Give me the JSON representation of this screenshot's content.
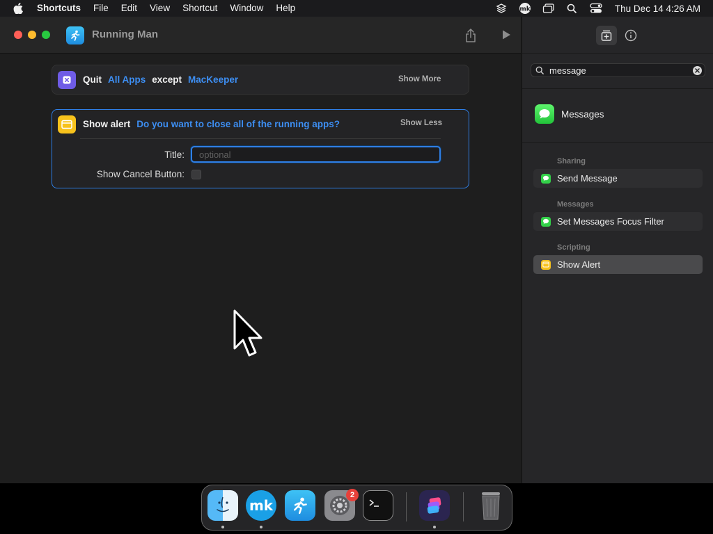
{
  "menubar": {
    "app_name": "Shortcuts",
    "menus": [
      "File",
      "Edit",
      "View",
      "Shortcut",
      "Window",
      "Help"
    ],
    "clock": "Thu Dec 14  4:26 AM"
  },
  "window": {
    "title": "Running Man"
  },
  "actions": {
    "quit": {
      "verb": "Quit",
      "target": "All Apps",
      "connector": "except",
      "exception": "MacKeeper",
      "toggle": "Show More"
    },
    "alert": {
      "verb": "Show alert",
      "message": "Do you want to close all of the running apps?",
      "toggle": "Show Less",
      "title_label": "Title:",
      "title_placeholder": "optional",
      "cancel_label": "Show Cancel Button:"
    }
  },
  "sidebar": {
    "search_value": "message",
    "app_result": "Messages",
    "sections": [
      {
        "header": "Sharing",
        "item": "Send Message"
      },
      {
        "header": "Messages",
        "item": "Set Messages Focus Filter"
      },
      {
        "header": "Scripting",
        "item": "Show Alert"
      }
    ]
  },
  "dock": {
    "settings_badge": "2"
  },
  "colors": {
    "accent": "#2f7fe6",
    "param_blue": "#3d8ef2",
    "messages_green": "#33d049",
    "alert_yellow": "#f7c21c",
    "quit_purple": "#6f5ce6"
  }
}
